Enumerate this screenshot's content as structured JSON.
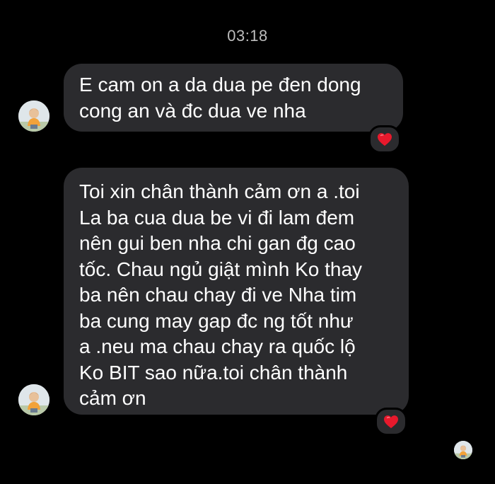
{
  "conversation": {
    "timestamp": "03:18",
    "messages": [
      {
        "text": "E cam on a da dua pe đen dong\ncong an và đc dua ve nha",
        "reaction": "heart-icon"
      },
      {
        "text": "Toi xin chân thành cảm ơn a .toi\nLa ba cua dua be vi đi lam đem\nnên gui ben nha chi gan đg cao\ntốc. Chau ngủ giật mình Ko thay\nba nên chau chay đi ve Nha tim\nba cung may gap đc ng tốt như\na .neu ma chau chay ra quốc lộ\nKo BIT sao nữa.toi chân thành\ncảm ơn",
        "reaction": "heart-icon"
      }
    ]
  },
  "colors": {
    "background": "#000000",
    "bubble": "#2b2b2e",
    "text": "#ffffff",
    "timestamp": "#bdbdbd",
    "heart": "#e8192c"
  }
}
